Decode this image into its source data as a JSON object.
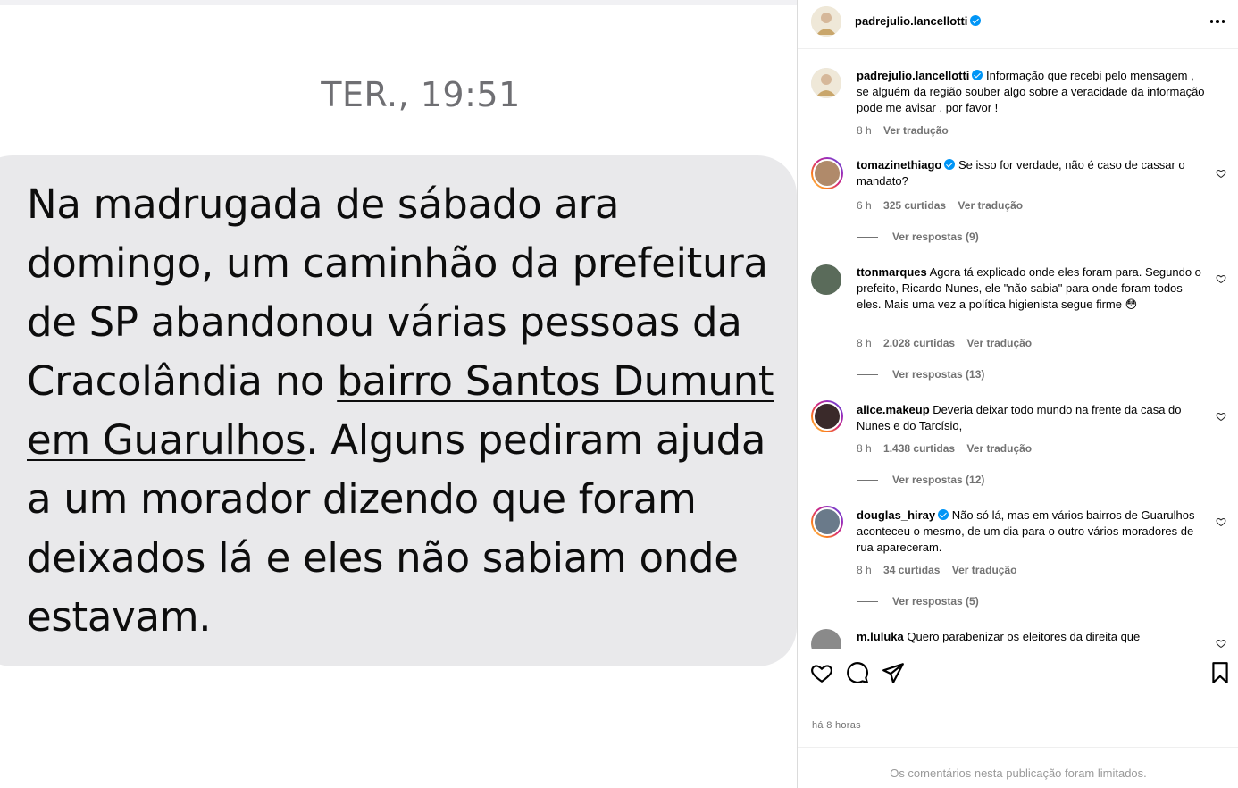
{
  "message": {
    "timestamp": "TER., 19:51",
    "text_before": "Na madrugada de sábado ara domingo, um caminhão da prefeitura de SP abandonou várias pessoas da Cracolândia no ",
    "text_link": "bairro Santos Dumunt em Guarulhos",
    "text_after": ". Alguns pediram ajuda a um morador dizendo que foram deixados lá e eles não sabiam onde estavam."
  },
  "header": {
    "username": "padrejulio.lancellotti",
    "more_icon": "more-horizontal-icon"
  },
  "caption": {
    "username": "padrejulio.lancellotti",
    "text": "Informação que recebi pelo mensagem , se alguém da região souber algo sobre a veracidade da informação pode me avisar , por favor !",
    "time": "8 h",
    "translate": "Ver tradução"
  },
  "comments": [
    {
      "username": "tomazinethiago",
      "verified": true,
      "text": "Se isso for verdade, não é caso de cassar o mandato?",
      "time": "6 h",
      "likes": "325 curtidas",
      "translate": "Ver tradução",
      "replies": "Ver respostas (9)",
      "avatar_color": "#b08a6a"
    },
    {
      "username": "ttonmarques",
      "verified": false,
      "text": "Agora tá explicado onde eles foram para. Segundo o prefeito, Ricardo Nunes, ele \"não sabia\" para onde foram todos eles. Mais uma vez a política higienista segue firme 😳",
      "time": "8 h",
      "likes": "2.028 curtidas",
      "translate": "Ver tradução",
      "replies": "Ver respostas (13)",
      "avatar_color": "#5a6b5a"
    },
    {
      "username": "alice.makeup",
      "verified": false,
      "text": "Deveria deixar todo mundo na frente da casa do Nunes e do Tarcísio,",
      "time": "8 h",
      "likes": "1.438 curtidas",
      "translate": "Ver tradução",
      "replies": "Ver respostas (12)",
      "avatar_color": "#3a2a2a"
    },
    {
      "username": "douglas_hiray",
      "verified": true,
      "text": "Não só lá, mas em vários bairros de Guarulhos aconteceu o mesmo, de um dia para o outro vários moradores de rua apareceram.",
      "time": "8 h",
      "likes": "34 curtidas",
      "translate": "Ver tradução",
      "replies": "Ver respostas (5)",
      "avatar_color": "#6a7a8a"
    },
    {
      "username": "m.luluka",
      "verified": false,
      "text": "Quero parabenizar os eleitores da direita que",
      "time": "",
      "likes": "",
      "translate": "",
      "replies": "",
      "avatar_color": "#8a8a8a"
    }
  ],
  "actions": {
    "like_icon": "heart-icon",
    "comment_icon": "comment-icon",
    "share_icon": "share-icon",
    "save_icon": "bookmark-icon",
    "time_ago": "há 8 horas"
  },
  "footer": {
    "limited_text": "Os comentários nesta publicação foram limitados."
  }
}
